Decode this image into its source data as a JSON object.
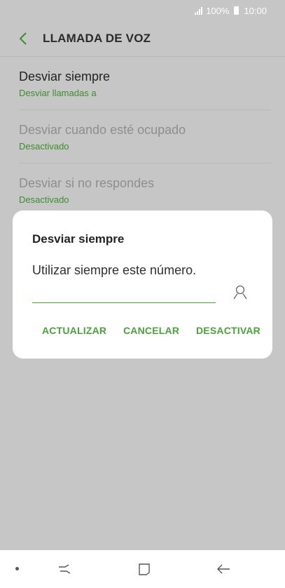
{
  "status_bar": {
    "battery": "100%",
    "time": "10:00"
  },
  "app_bar": {
    "title": "LLAMADA DE VOZ",
    "back_icon": "chevron-left-icon"
  },
  "settings": [
    {
      "title": "Desviar siempre",
      "subtitle": "Desviar llamadas a",
      "enabled": true
    },
    {
      "title": "Desviar cuando esté ocupado",
      "subtitle": "Desactivado",
      "enabled": false
    },
    {
      "title": "Desviar si no respondes",
      "subtitle": "Desactivado",
      "enabled": false
    }
  ],
  "dialog": {
    "title": "Desviar siempre",
    "message": "Utilizar siempre este número.",
    "input_value": "",
    "contact_icon": "person-icon",
    "buttons": {
      "update": "ACTUALIZAR",
      "cancel": "CANCELAR",
      "deactivate": "DESACTIVAR"
    }
  },
  "nav_bar": {
    "recent_icon": "recent-apps-icon",
    "home_icon": "home-icon",
    "back_icon": "back-arrow-icon"
  },
  "colors": {
    "accent": "#4aa33a",
    "scrim": "#c6c6c6",
    "dialog_bg": "#ffffff"
  }
}
